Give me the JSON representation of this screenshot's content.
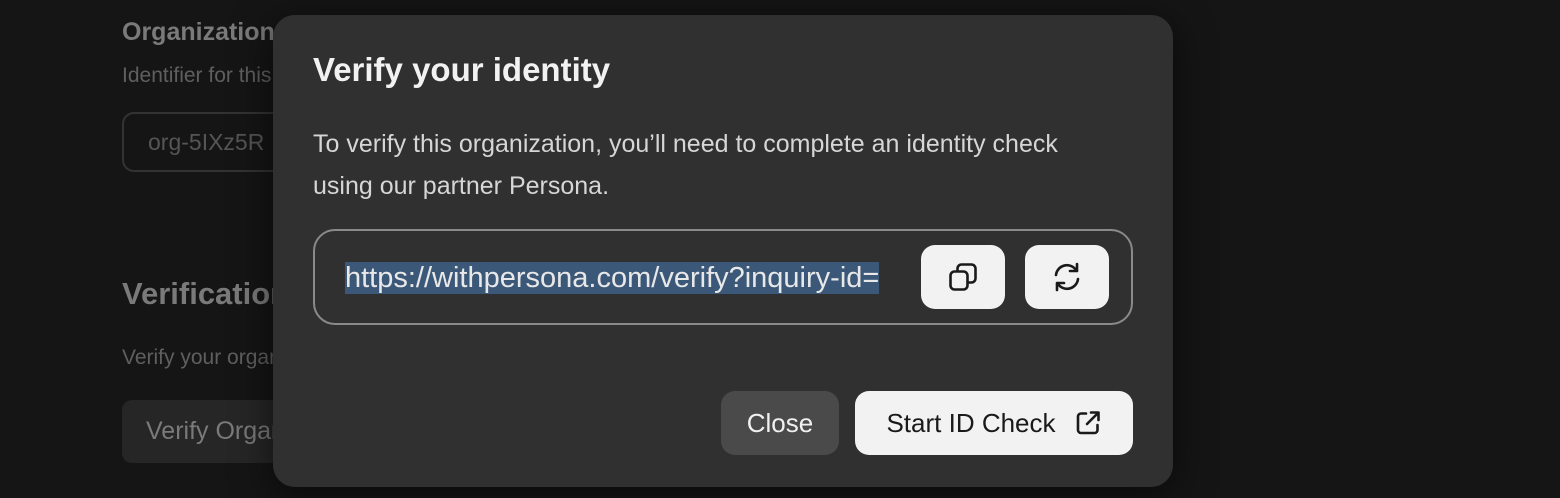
{
  "background": {
    "organization": {
      "title": "Organization ID",
      "subtitle": "Identifier for this organization",
      "input_value": "org-5IXz5R"
    },
    "verification": {
      "title": "Verification",
      "subtitle": "Verify your organization",
      "button_label": "Verify Organization"
    }
  },
  "modal": {
    "title": "Verify your identity",
    "description": "To verify this organization, you’ll need to complete an identity check using our partner Persona.",
    "url": "https://withpersona.com/verify?inquiry-id=",
    "copy_icon": "copy-icon",
    "refresh_icon": "refresh-icon",
    "close_label": "Close",
    "start_label": "Start ID Check",
    "start_icon": "external-link-icon"
  },
  "colors": {
    "overlay_bg": "#151515",
    "modal_bg": "#303030",
    "selection": "#3b5878",
    "light_button": "#f2f2f2"
  }
}
